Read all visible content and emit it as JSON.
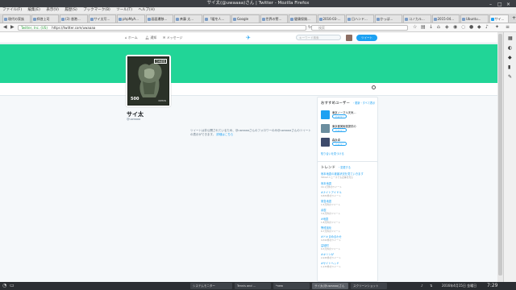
{
  "window": {
    "title": "サイ太(@uwaaaa)さん | Twitter - Mozilla Firefox",
    "controls": [
      "–",
      "□",
      "×"
    ]
  },
  "menu": [
    "ファイル(F)",
    "編集(E)",
    "表示(V)",
    "履歴(S)",
    "ブックマーク(B)",
    "ツール(T)",
    "ヘルプ(H)"
  ],
  "tabs": [
    {
      "label": "現代の家族"
    },
    {
      "label": "拝啓上司"
    },
    {
      "label": "(3) 香港..."
    },
    {
      "label": "サイ太写..."
    },
    {
      "label": "phpMyA..."
    },
    {
      "label": "画面遷移..."
    },
    {
      "label": "斉藤 太..."
    },
    {
      "label": "「暖冬人..."
    },
    {
      "label": "Google"
    },
    {
      "label": "世界の警..."
    },
    {
      "label": "健康保険..."
    },
    {
      "label": "2016-03-..."
    },
    {
      "label": "日ハンド..."
    },
    {
      "label": "かっぱ..."
    },
    {
      "label": "コノカル..."
    },
    {
      "label": "2015-04..."
    },
    {
      "label": "Ubuntu..."
    },
    {
      "label": "サイ..."
    }
  ],
  "url": {
    "secure_label": "Twitter, Inc. (US)",
    "value": "https://twitter.com/uwaaaa"
  },
  "browser_search": {
    "placeholder": "検索"
  },
  "twitter": {
    "nav": [
      {
        "label": "ホーム"
      },
      {
        "label": "通知"
      },
      {
        "label": "メッセージ"
      }
    ],
    "search_placeholder": "キーワード検索",
    "tweet_button": "ツイート",
    "profile": {
      "avatar_price": "500",
      "avatar_country": "NIPPON",
      "avatar_kanji": "日本郵便",
      "name": "サイ太",
      "handle": "@uwaaaa",
      "protected_text": "ツイートは非公開されているため、@uwaaaaさんのフォロワーのみ@uwaaaaさんのツイートの表示ができます。",
      "protected_link": "詳細はこちら"
    },
    "recommend": {
      "title": "おすすめユーザー",
      "links": "・更新・すべて表示",
      "users": [
        {
          "name": "東京ノーマル天気...",
          "handle": "@tenkeiid",
          "follow": "フォロー",
          "color": "#1da1f2"
        },
        {
          "name": "東京都美術館提供の",
          "handle": "",
          "follow": "フォロー",
          "color": "#6b8e9f"
        },
        {
          "name": "森永卓",
          "handle": "",
          "follow": "フォロー",
          "color": "#3d4a6b"
        }
      ],
      "footer": "知り合いを見つける"
    },
    "trends": {
      "title": "トレンド",
      "change": "・変更する",
      "items": [
        {
          "name": "熊本地震の被害状況を見ていきます",
          "count": "Yahoo!ニュースでも記事を見る"
        },
        {
          "name": "熊本地震",
          "count": "14.1万件のツイート"
        },
        {
          "name": "#ナイトアイドル",
          "count": "9,834件のツイート"
        },
        {
          "name": "緊急地震",
          "count": "1.5万件のツイート"
        },
        {
          "name": "余震",
          "count": "3.4万件のツイート"
        },
        {
          "name": "#地震",
          "count": "1.8万件のツイート"
        },
        {
          "name": "警戒強化",
          "count": "6.7万件のツイート"
        },
        {
          "name": "#ドキまめ合わせ",
          "count": "4,322件のツイート"
        },
        {
          "name": "益城町",
          "count": "9.3万件のツイート"
        },
        {
          "name": "#キリンが",
          "count": "2,245件のツイート"
        },
        {
          "name": "#サイトヘッド",
          "count": "1,133件のツイート"
        }
      ]
    }
  },
  "taskbar": {
    "items": [
      {
        "label": "システムモニター"
      },
      {
        "label": "Tennis and ..."
      },
      {
        "label": "*new"
      },
      {
        "label": "サイ太(@uwaaaa)さん"
      },
      {
        "label": "スクリーンショット"
      }
    ],
    "date": "2016年4月15日 金曜日",
    "time": "7:29"
  }
}
